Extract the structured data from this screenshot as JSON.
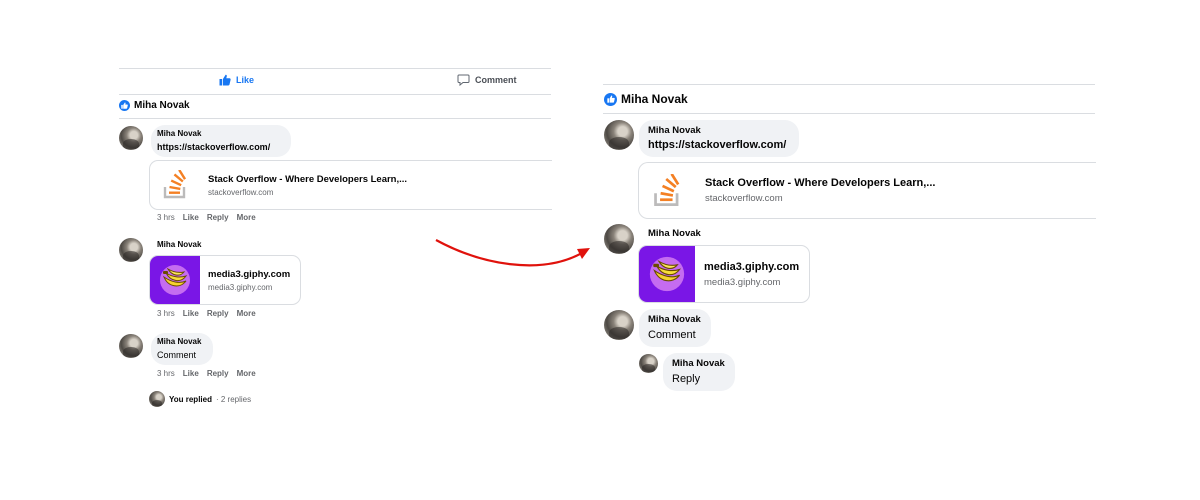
{
  "left": {
    "actions": {
      "like_label": "Like",
      "comment_label": "Comment"
    },
    "header": {
      "name": "Miha Novak"
    },
    "comments": [
      {
        "author": "Miha Novak",
        "text": "https://stackoverflow.com/",
        "card": {
          "title": "Stack Overflow - Where Developers Learn,...",
          "domain": "stackoverflow.com"
        },
        "meta": {
          "time": "3 hrs",
          "like": "Like",
          "reply": "Reply",
          "more": "More"
        }
      },
      {
        "author": "Miha Novak",
        "card": {
          "title": "media3.giphy.com",
          "domain": "media3.giphy.com"
        },
        "meta": {
          "time": "3 hrs",
          "like": "Like",
          "reply": "Reply",
          "more": "More"
        }
      },
      {
        "author": "Miha Novak",
        "text": "Comment",
        "meta": {
          "time": "3 hrs",
          "like": "Like",
          "reply": "Reply",
          "more": "More"
        }
      }
    ],
    "replies": {
      "you_replied": "You replied",
      "count": "· 2 replies"
    }
  },
  "right": {
    "header": {
      "name": "Miha Novak"
    },
    "comments": [
      {
        "author": "Miha Novak",
        "text": "https://stackoverflow.com/",
        "card": {
          "title": "Stack Overflow - Where Developers Learn,...",
          "domain": "stackoverflow.com"
        }
      },
      {
        "author": "Miha Novak",
        "card": {
          "title": "media3.giphy.com",
          "domain": "media3.giphy.com"
        }
      },
      {
        "author": "Miha Novak",
        "text": "Comment"
      },
      {
        "author": "Miha Novak",
        "text": "Reply"
      }
    ]
  },
  "colors": {
    "accent": "#1877f2",
    "bubble": "#f0f2f5",
    "meta": "#65676b",
    "arrow": "#e0120c",
    "giphy": "#7a16e6",
    "so_orange": "#f48024",
    "so_gray": "#bcbbbb"
  },
  "icons": {
    "like": "thumbs-up-icon",
    "comment": "speech-bubble-icon",
    "badge": "like-badge-icon"
  }
}
